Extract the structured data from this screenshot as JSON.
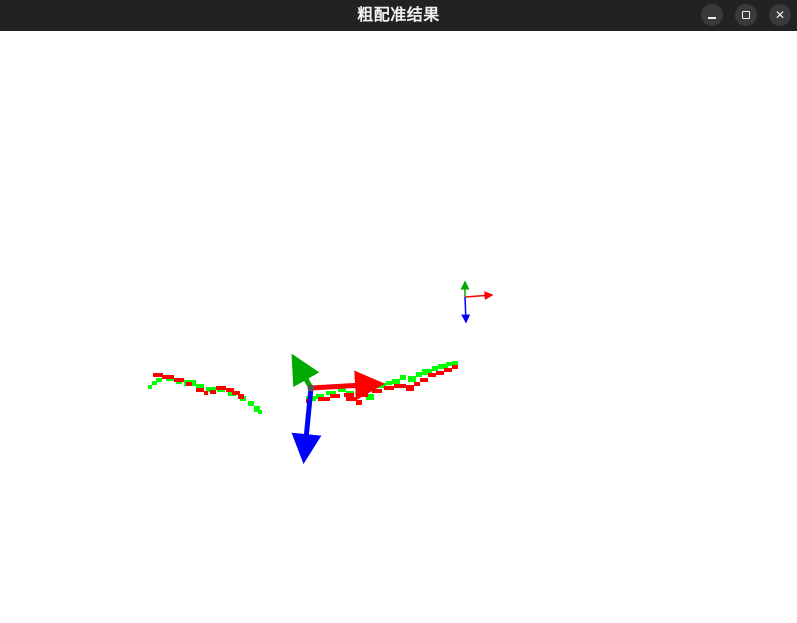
{
  "window": {
    "title": "粗配准结果"
  },
  "controls": {
    "minimize_icon": "minimize-icon",
    "maximize_icon": "maximize-icon",
    "close_icon": "close-icon",
    "close_glyph": "✕"
  },
  "viewport": {
    "background": "#ffffff",
    "colors": {
      "source_cloud": "#ff0000",
      "target_cloud": "#00ff00",
      "axis_x": "#ff0000",
      "axis_y": "#00aa00",
      "axis_z": "#0000ff"
    }
  }
}
